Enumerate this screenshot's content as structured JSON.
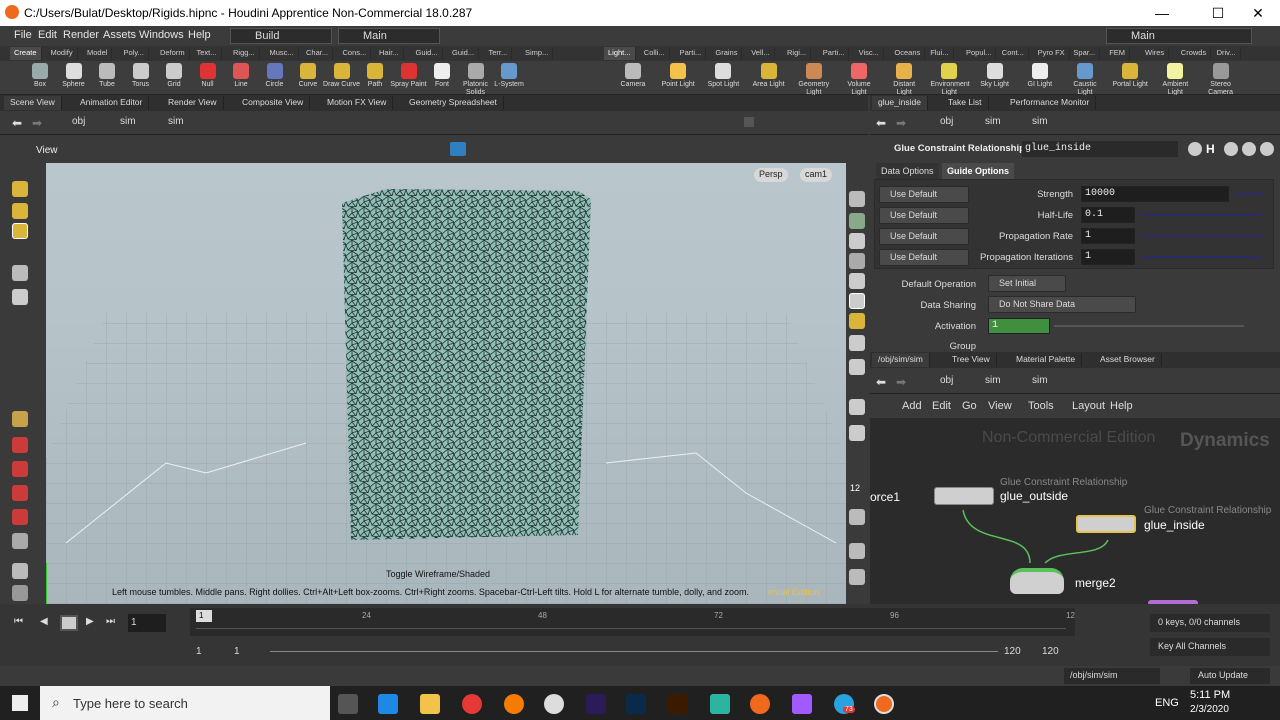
{
  "window": {
    "title": "C:/Users/Bulat/Desktop/Rigids.hipnc - Houdini Apprentice Non-Commercial 18.0.287",
    "min": "—",
    "max": "☐",
    "close": "✕"
  },
  "menu": [
    "File",
    "Edit",
    "Render",
    "Assets",
    "Windows",
    "Help"
  ],
  "desktops": {
    "build": "Build",
    "main": "Main",
    "main_right": "Main"
  },
  "shelf_tabs_left": [
    "Create",
    "Modify",
    "Model",
    "Poly...",
    "Deform",
    "Text...",
    "Rigg...",
    "Musc...",
    "Char...",
    "Cons...",
    "Hair...",
    "Guid...",
    "Guid...",
    "Terr...",
    "Simp..."
  ],
  "shelf_tabs_right": [
    "Light...",
    "Colli...",
    "Parti...",
    "Grains",
    "Vell...",
    "Rigi...",
    "Parti...",
    "Visc...",
    "Oceans",
    "Flui...",
    "Popul...",
    "Cont...",
    "Pyro FX",
    "Spar...",
    "FEM",
    "Wires",
    "Crowds",
    "Driv..."
  ],
  "tools_left": [
    "Box",
    "Sphere",
    "Tube",
    "Torus",
    "Grid",
    "Null",
    "Line",
    "Circle",
    "Curve",
    "Draw Curve",
    "Path",
    "Spray Paint",
    "Font",
    "Platonic Solids",
    "L-System"
  ],
  "tools_right": [
    "Camera",
    "Point Light",
    "Spot Light",
    "Area Light",
    "Geometry Light",
    "Volume Light",
    "Distant Light",
    "Environment Light",
    "Sky Light",
    "GI Light",
    "Caustic Light",
    "Portal Light",
    "Ambient Light",
    "Stereo Camera"
  ],
  "left_tabs": [
    "Scene View",
    "Animation Editor",
    "Render View",
    "Composite View",
    "Motion FX View",
    "Geometry Spreadsheet"
  ],
  "path": {
    "obj": "obj",
    "sim1": "sim",
    "sim2": "sim"
  },
  "viewport": {
    "title": "View",
    "persp": "Persp",
    "cam": "cam1",
    "toggle": "Toggle Wireframe/Shaded",
    "hint": "Left mouse tumbles. Middle pans. Right dollies. Ctrl+Alt+Left box-zooms. Ctrl+Right zooms. Spacebar-Ctrl-Left tilts. Hold L for alternate tumble, dolly, and zoom.",
    "edition": "ercial Edition"
  },
  "param_tabs": [
    "glue_inside",
    "Take List",
    "Performance Monitor"
  ],
  "params": {
    "node_type": "Glue Constraint Relationship",
    "node_name": "glue_inside",
    "tab_data": "Data Options",
    "tab_guide": "Guide Options",
    "use_default": "Use Default",
    "rows": [
      {
        "label": "Strength",
        "value": "10000"
      },
      {
        "label": "Half-Life",
        "value": "0.1"
      },
      {
        "label": "Propagation Rate",
        "value": "1"
      },
      {
        "label": "Propagation Iterations",
        "value": "1"
      }
    ],
    "default_op_label": "Default Operation",
    "default_op": "Set Initial",
    "sharing_label": "Data Sharing",
    "sharing": "Do Not Share Data",
    "activation_label": "Activation",
    "activation": "1",
    "group_label": "Group"
  },
  "net_tabs": [
    "/obj/sim/sim",
    "Tree View",
    "Material Palette",
    "Asset Browser"
  ],
  "net_menu": [
    "Add",
    "Edit",
    "Go",
    "View",
    "Tools",
    "Layout",
    "Help"
  ],
  "network": {
    "watermark1": "Non-Commercial Edition",
    "watermark2": "Dynamics",
    "n1_type": "Glue Constraint Relationship",
    "n1_name": "glue_outside",
    "n2_type": "Glue Constraint Relationship",
    "n2_name": "glue_inside",
    "merge": "merge2",
    "force": "orce1"
  },
  "timeline": {
    "frame": "1",
    "start": "1",
    "start2": "1",
    "end": "120",
    "end2": "120",
    "ticks": [
      "1",
      "24",
      "48",
      "72",
      "96",
      "12"
    ],
    "keys": "0 keys, 0/0 channels",
    "keyall": "Key All Channels"
  },
  "status": {
    "path": "/obj/sim/sim",
    "update": "Auto Update"
  },
  "taskbar": {
    "search": "Type here to search",
    "lang": "ENG",
    "time": "5:11 PM",
    "date": "2/3/2020",
    "badge": "73"
  }
}
